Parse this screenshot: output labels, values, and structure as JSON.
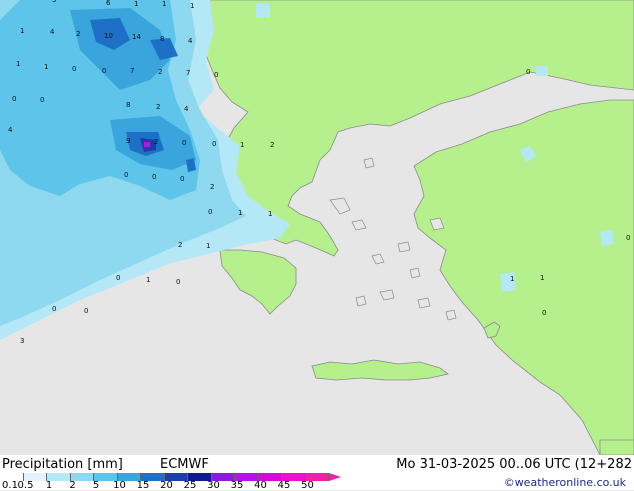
{
  "footer": {
    "title": "Precipitation [mm]",
    "model": "ECMWF",
    "datetime": "Mo 31-03-2025 00..06 UTC (12+282",
    "credit": "©weatheronline.co.uk"
  },
  "legend": {
    "labels": [
      "0.1",
      "0.5",
      "1",
      "2",
      "5",
      "10",
      "15",
      "20",
      "25",
      "30",
      "35",
      "40",
      "45",
      "50"
    ],
    "colors": [
      "#ffffff",
      "#dff4fb",
      "#b4e8f6",
      "#8ed8f0",
      "#5ec4ea",
      "#3aa4dc",
      "#1e6fc6",
      "#1b3ea8",
      "#101c8c",
      "#8c1cdc",
      "#b414e6",
      "#d40cd8",
      "#e616c8",
      "#f020a8"
    ]
  },
  "colors": {
    "sea": "#e6e6e6",
    "land": "#b6f08c",
    "coast": "#8a8a8a"
  },
  "map_numbers": [
    "3",
    "6",
    "1",
    "1",
    "1",
    "1",
    "4",
    "2",
    "10",
    "14",
    "8",
    "4",
    "1",
    "1",
    "0",
    "0",
    "7",
    "2",
    "7",
    "0",
    "0",
    "0",
    "8",
    "2",
    "4",
    "4",
    "9",
    "2",
    "0",
    "0",
    "1",
    "2",
    "0",
    "0",
    "0",
    "2",
    "0",
    "1",
    "1",
    "2",
    "1",
    "0",
    "1",
    "0",
    "3",
    "0",
    "0",
    "1",
    "1",
    "0",
    "0",
    "0"
  ]
}
